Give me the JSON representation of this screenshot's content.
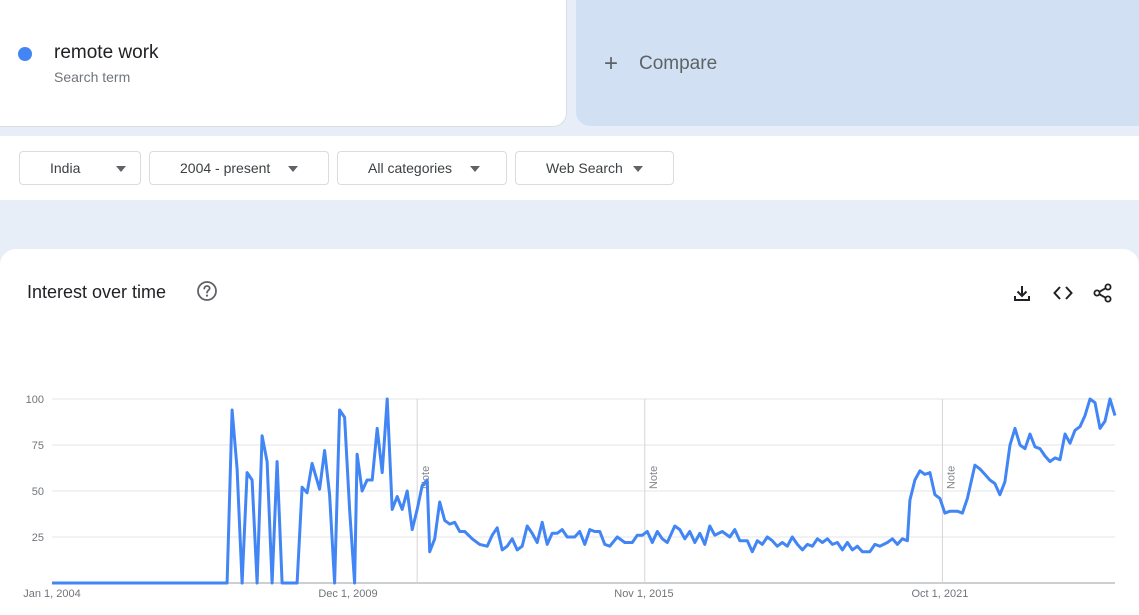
{
  "search_term": {
    "name": "remote work",
    "sublabel": "Search term",
    "color": "#4285f4"
  },
  "compare": {
    "label": "Compare"
  },
  "filters": [
    {
      "label": "India"
    },
    {
      "label": "2004 - present"
    },
    {
      "label": "All categories"
    },
    {
      "label": "Web Search"
    }
  ],
  "chart_card": {
    "title": "Interest over time",
    "help_icon": "help-circle-icon",
    "tools": [
      "download-icon",
      "embed-code-icon",
      "share-icon"
    ]
  },
  "chart_data": {
    "type": "line",
    "title": "Interest over time",
    "xlabel": "",
    "ylabel": "",
    "ylim": [
      0,
      100
    ],
    "yticks": [
      25,
      50,
      75,
      100
    ],
    "xtick_labels": [
      "Jan 1, 2004",
      "Dec 1, 2009",
      "Nov 1, 2015",
      "Oct 1, 2021"
    ],
    "xtick_years": [
      2004.0,
      2009.917,
      2015.833,
      2021.75
    ],
    "x_range": [
      2004.0,
      2024.5
    ],
    "notes": [
      {
        "year": 2011.0,
        "label": "Note"
      },
      {
        "year": 2016.0,
        "label": "Note"
      },
      {
        "year": 2022.0,
        "label": "Note"
      }
    ],
    "series": [
      {
        "color": "#4285f4",
        "points": [
          [
            2004.0,
            0
          ],
          [
            2007.5,
            0
          ],
          [
            2007.6,
            94
          ],
          [
            2007.7,
            62
          ],
          [
            2007.8,
            0
          ],
          [
            2007.9,
            60
          ],
          [
            2008.0,
            56
          ],
          [
            2008.1,
            0
          ],
          [
            2008.2,
            80
          ],
          [
            2008.3,
            66
          ],
          [
            2008.4,
            0
          ],
          [
            2008.5,
            66
          ],
          [
            2008.6,
            0
          ],
          [
            2008.7,
            0
          ],
          [
            2008.9,
            0
          ],
          [
            2009.0,
            52
          ],
          [
            2009.1,
            49
          ],
          [
            2009.2,
            65
          ],
          [
            2009.35,
            51
          ],
          [
            2009.45,
            72
          ],
          [
            2009.55,
            48
          ],
          [
            2009.65,
            0
          ],
          [
            2009.75,
            94
          ],
          [
            2009.85,
            90
          ],
          [
            2009.95,
            40
          ],
          [
            2010.05,
            0
          ],
          [
            2010.1,
            70
          ],
          [
            2010.2,
            50
          ],
          [
            2010.3,
            56
          ],
          [
            2010.4,
            56
          ],
          [
            2010.5,
            84
          ],
          [
            2010.6,
            60
          ],
          [
            2010.7,
            100
          ],
          [
            2010.8,
            40
          ],
          [
            2010.9,
            47
          ],
          [
            2011.0,
            40
          ],
          [
            2011.1,
            50
          ],
          [
            2011.2,
            29
          ],
          [
            2011.3,
            40
          ],
          [
            2011.4,
            53
          ],
          [
            2011.5,
            56
          ],
          [
            2011.55,
            17
          ],
          [
            2011.65,
            24
          ],
          [
            2011.75,
            44
          ],
          [
            2011.85,
            34
          ],
          [
            2011.95,
            32
          ],
          [
            2012.05,
            33
          ],
          [
            2012.15,
            28
          ],
          [
            2012.25,
            28
          ],
          [
            2012.4,
            24
          ],
          [
            2012.55,
            21
          ],
          [
            2012.7,
            20
          ],
          [
            2012.8,
            26
          ],
          [
            2012.9,
            30
          ],
          [
            2013.0,
            18
          ],
          [
            2013.1,
            20
          ],
          [
            2013.2,
            24
          ],
          [
            2013.3,
            18
          ],
          [
            2013.4,
            20
          ],
          [
            2013.5,
            31
          ],
          [
            2013.6,
            27
          ],
          [
            2013.7,
            22
          ],
          [
            2013.8,
            33
          ],
          [
            2013.9,
            21
          ],
          [
            2014.0,
            27
          ],
          [
            2014.1,
            27
          ],
          [
            2014.2,
            29
          ],
          [
            2014.3,
            25
          ],
          [
            2014.45,
            25
          ],
          [
            2014.55,
            28
          ],
          [
            2014.65,
            21
          ],
          [
            2014.75,
            29
          ],
          [
            2014.85,
            28
          ],
          [
            2014.95,
            28
          ],
          [
            2015.05,
            21
          ],
          [
            2015.15,
            20
          ],
          [
            2015.3,
            25
          ],
          [
            2015.45,
            22
          ],
          [
            2015.6,
            22
          ],
          [
            2015.7,
            26
          ],
          [
            2015.8,
            26
          ],
          [
            2015.9,
            28
          ],
          [
            2016.0,
            22
          ],
          [
            2016.1,
            28
          ],
          [
            2016.2,
            24
          ],
          [
            2016.3,
            22
          ],
          [
            2016.45,
            31
          ],
          [
            2016.55,
            29
          ],
          [
            2016.65,
            24
          ],
          [
            2016.75,
            28
          ],
          [
            2016.85,
            22
          ],
          [
            2016.95,
            27
          ],
          [
            2017.05,
            21
          ],
          [
            2017.15,
            31
          ],
          [
            2017.25,
            26
          ],
          [
            2017.4,
            28
          ],
          [
            2017.55,
            25
          ],
          [
            2017.65,
            29
          ],
          [
            2017.75,
            23
          ],
          [
            2017.9,
            23
          ],
          [
            2018.0,
            17
          ],
          [
            2018.1,
            23
          ],
          [
            2018.2,
            21
          ],
          [
            2018.3,
            25
          ],
          [
            2018.4,
            23
          ],
          [
            2018.5,
            20
          ],
          [
            2018.6,
            22
          ],
          [
            2018.7,
            20
          ],
          [
            2018.8,
            25
          ],
          [
            2018.9,
            21
          ],
          [
            2019.0,
            18
          ],
          [
            2019.1,
            21
          ],
          [
            2019.2,
            20
          ],
          [
            2019.3,
            24
          ],
          [
            2019.4,
            22
          ],
          [
            2019.5,
            24
          ],
          [
            2019.6,
            21
          ],
          [
            2019.7,
            22
          ],
          [
            2019.8,
            18
          ],
          [
            2019.9,
            22
          ],
          [
            2020.0,
            18
          ],
          [
            2020.1,
            20
          ],
          [
            2020.2,
            17
          ],
          [
            2020.35,
            17
          ],
          [
            2020.45,
            21
          ],
          [
            2020.55,
            20
          ],
          [
            2020.7,
            22
          ],
          [
            2020.8,
            24
          ],
          [
            2020.9,
            21
          ],
          [
            2021.0,
            24
          ],
          [
            2021.1,
            23
          ],
          [
            2021.15,
            45
          ],
          [
            2021.25,
            56
          ],
          [
            2021.35,
            61
          ],
          [
            2021.45,
            59
          ],
          [
            2021.55,
            60
          ],
          [
            2021.65,
            48
          ],
          [
            2021.75,
            46
          ],
          [
            2021.85,
            38
          ],
          [
            2021.95,
            39
          ],
          [
            2022.1,
            39
          ],
          [
            2022.2,
            38
          ],
          [
            2022.3,
            46
          ],
          [
            2022.45,
            64
          ],
          [
            2022.55,
            62
          ],
          [
            2022.65,
            59
          ],
          [
            2022.75,
            56
          ],
          [
            2022.85,
            54
          ],
          [
            2022.95,
            48
          ],
          [
            2023.05,
            55
          ],
          [
            2023.15,
            75
          ],
          [
            2023.25,
            84
          ],
          [
            2023.35,
            75
          ],
          [
            2023.45,
            73
          ],
          [
            2023.55,
            81
          ],
          [
            2023.65,
            74
          ],
          [
            2023.75,
            73
          ],
          [
            2023.85,
            69
          ],
          [
            2023.95,
            66
          ],
          [
            2024.05,
            68
          ],
          [
            2024.15,
            67
          ],
          [
            2024.25,
            81
          ],
          [
            2024.35,
            76
          ],
          [
            2024.45,
            83
          ],
          [
            2024.55,
            85
          ],
          [
            2024.65,
            91
          ],
          [
            2024.75,
            100
          ],
          [
            2024.85,
            98
          ],
          [
            2024.95,
            84
          ],
          [
            2025.05,
            88
          ],
          [
            2025.15,
            100
          ],
          [
            2025.25,
            91
          ]
        ]
      }
    ]
  }
}
